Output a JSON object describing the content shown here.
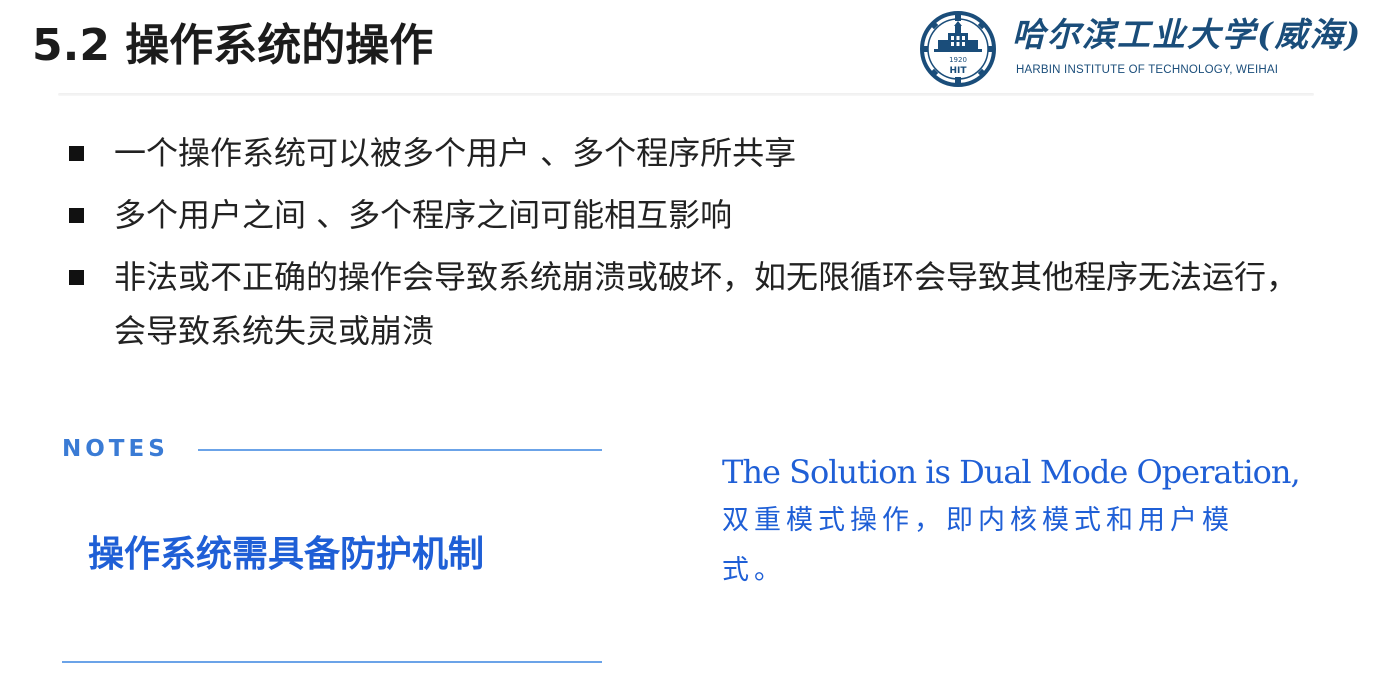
{
  "header": {
    "title": "5.2 操作系统的操作"
  },
  "logo": {
    "cn_name": "哈尔滨工业大学(威海)",
    "en_name": "HARBIN INSTITUTE OF TECHNOLOGY, WEIHAI",
    "emblem_year": "1920",
    "emblem_abbr": "HIT",
    "color": "#1a4d7a"
  },
  "bullets": [
    {
      "text": "一个操作系统可以被多个用户 、多个程序所共享"
    },
    {
      "text": "多个用户之间 、多个程序之间可能相互影响"
    },
    {
      "text": "非法或不正确的操作会导致系统崩溃或破坏，如无限循环会导致其他程序无法运行，会导致系统失灵或崩溃"
    }
  ],
  "notes": {
    "label": "NOTES",
    "text": "操作系统需具备防护机制",
    "color": "#1f5fd6",
    "line_color": "#6ba3e8"
  },
  "solution": {
    "en": "The Solution is Dual Mode Operation,",
    "cn": "双重模式操作，即内核模式和用户模式。",
    "color": "#1f5fd6"
  }
}
